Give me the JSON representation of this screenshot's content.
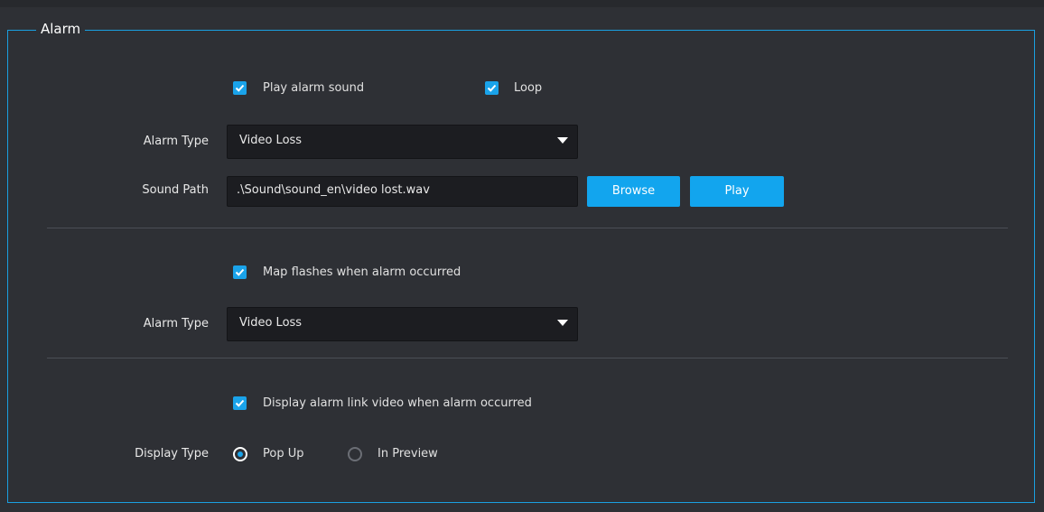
{
  "section": {
    "title": "Alarm"
  },
  "sound": {
    "play_alarm_sound": {
      "label": "Play alarm sound",
      "checked": true
    },
    "loop": {
      "label": "Loop",
      "checked": true
    },
    "alarm_type_label": "Alarm Type",
    "alarm_type_value": "Video Loss",
    "sound_path_label": "Sound Path",
    "sound_path_value": ".\\Sound\\sound_en\\video lost.wav",
    "browse_label": "Browse",
    "play_label": "Play"
  },
  "map": {
    "map_flashes": {
      "label": "Map flashes when alarm occurred",
      "checked": true
    },
    "alarm_type_label": "Alarm Type",
    "alarm_type_value": "Video Loss"
  },
  "video": {
    "display_link_video": {
      "label": "Display alarm link video when alarm occurred",
      "checked": true
    },
    "display_type_label": "Display Type",
    "options": [
      {
        "label": "Pop Up",
        "selected": true
      },
      {
        "label": "In Preview",
        "selected": false
      }
    ]
  },
  "colors": {
    "accent": "#1aa3ea",
    "background": "#2e3035",
    "field": "#1c1d21"
  },
  "icons": {
    "checkbox": "checkmark-icon",
    "dropdown": "chevron-down-icon"
  }
}
